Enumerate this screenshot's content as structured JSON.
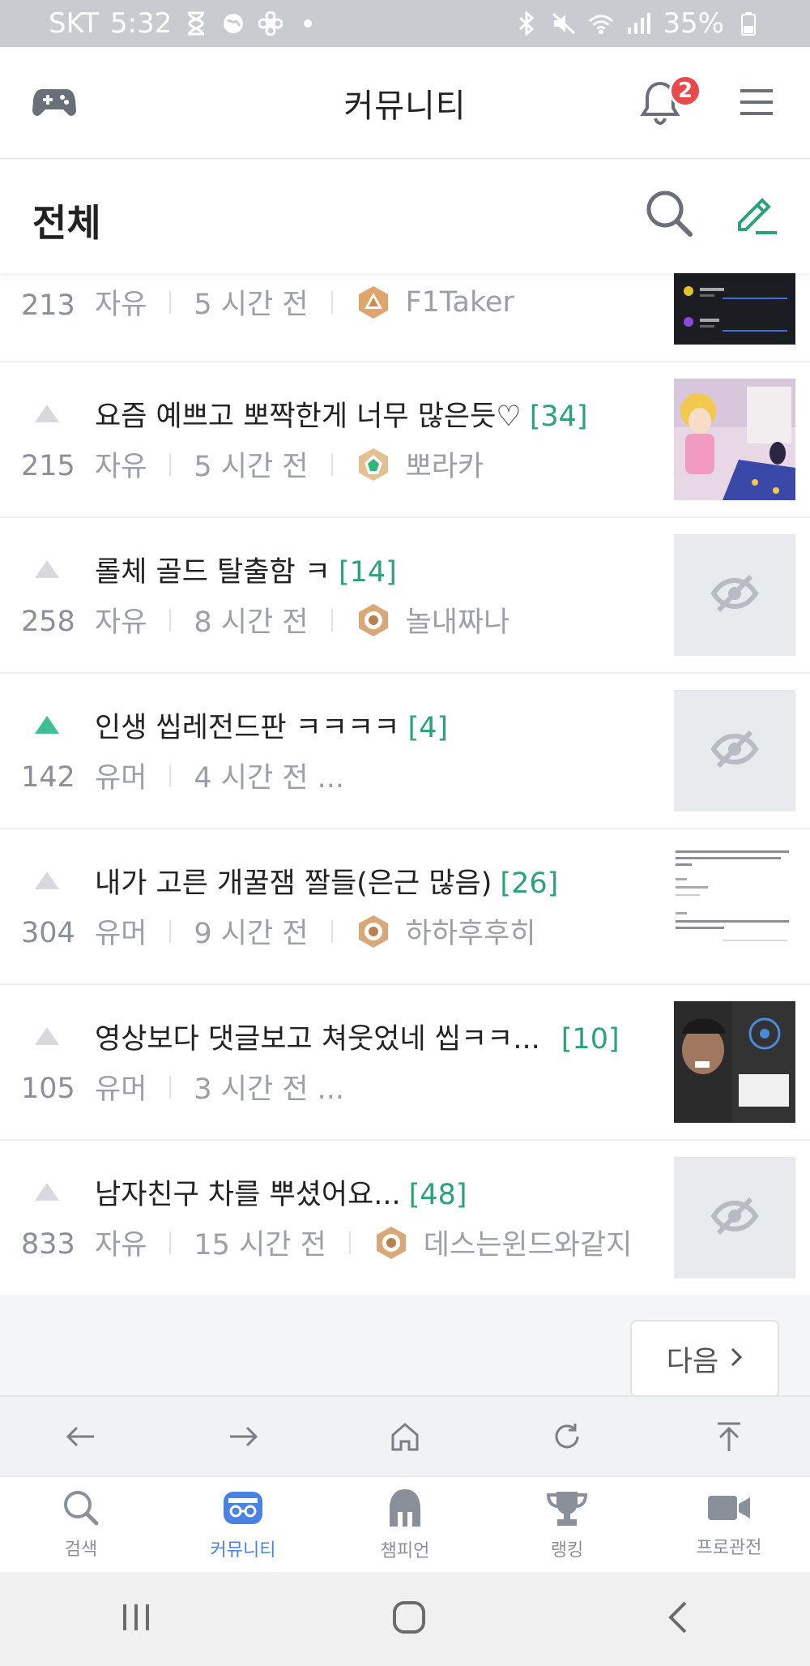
{
  "status_bar": {
    "carrier": "SKT",
    "time": "5:32",
    "battery": "35%"
  },
  "header": {
    "title": "커뮤니티",
    "notification_count": "2"
  },
  "board": {
    "title": "전체"
  },
  "posts": [
    {
      "votes": "213",
      "title": "",
      "comments": "",
      "category": "자유",
      "time": "5 시간 전",
      "author": "F1Taker",
      "vote_active": false,
      "thumb": "screenshot"
    },
    {
      "votes": "215",
      "title": "요즘 예쁘고 뽀짝한게 너무 많은듯♡",
      "comments": "[34]",
      "category": "자유",
      "time": "5 시간 전",
      "author": "뽀라카",
      "vote_active": false,
      "thumb": "anime"
    },
    {
      "votes": "258",
      "title": "롤체 골드 탈출함 ㅋ",
      "comments": "[14]",
      "category": "자유",
      "time": "8 시간 전",
      "author": "놀내짜나",
      "vote_active": false,
      "thumb": "hidden"
    },
    {
      "votes": "142",
      "title": "인생 씹레전드판 ㅋㅋㅋㅋ",
      "comments": "[4]",
      "category": "유머",
      "time": "4 시간 전 ...",
      "author": "",
      "vote_active": true,
      "thumb": "hidden"
    },
    {
      "votes": "304",
      "title": "내가 고른 개꿀잼 짤들(은근 많음)",
      "comments": "[26]",
      "category": "유머",
      "time": "9 시간 전",
      "author": "하하후후히",
      "vote_active": false,
      "thumb": "text"
    },
    {
      "votes": "105",
      "title": "영상보다 댓글보고 쳐웃었네 씹ㅋㅋ...",
      "comments": "[10]",
      "category": "유머",
      "time": "3 시간 전 ...",
      "author": "",
      "vote_active": false,
      "thumb": "video"
    },
    {
      "votes": "833",
      "title": "남자친구 차를 뿌셨어요...",
      "comments": "[48]",
      "category": "자유",
      "time": "15 시간 전",
      "author": "데스는윈드와같지",
      "vote_active": false,
      "thumb": "hidden"
    }
  ],
  "pagination": {
    "next_label": "다음"
  },
  "bottom_tabs": [
    {
      "label": "검색",
      "icon": "search-icon"
    },
    {
      "label": "커뮤니티",
      "icon": "community-icon"
    },
    {
      "label": "챔피언",
      "icon": "champion-helmet-icon"
    },
    {
      "label": "랭킹",
      "icon": "trophy-icon"
    },
    {
      "label": "프로관전",
      "icon": "video-camera-icon"
    }
  ],
  "colors": {
    "accent_green": "#2aa37a",
    "active_tab_blue": "#4a82e4",
    "badge_red": "#e84a4a"
  }
}
